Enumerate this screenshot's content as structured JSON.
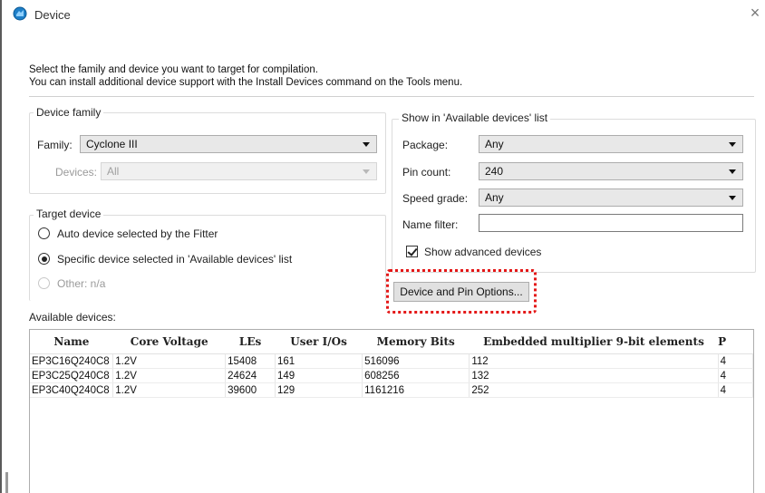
{
  "window": {
    "title": "Device",
    "close_glyph": "×"
  },
  "intro": {
    "line1": "Select the family and device you want to target for compilation.",
    "line2": "You can install additional device support with the Install Devices command on the Tools menu."
  },
  "device_family": {
    "legend": "Device family",
    "family_label": "Family:",
    "family_value": "Cyclone III",
    "devices_label": "Devices:",
    "devices_value": "All"
  },
  "target_device": {
    "legend": "Target device",
    "options": [
      {
        "label": "Auto device selected by the Fitter",
        "checked": false,
        "enabled": true
      },
      {
        "label": "Specific device selected in 'Available devices' list",
        "checked": true,
        "enabled": true
      },
      {
        "label": "Other:  n/a",
        "checked": false,
        "enabled": false
      }
    ]
  },
  "show_in_list": {
    "legend": "Show in 'Available devices' list",
    "package_label": "Package:",
    "package_value": "Any",
    "pin_count_label": "Pin count:",
    "pin_count_value": "240",
    "speed_grade_label": "Speed grade:",
    "speed_grade_value": "Any",
    "name_filter_label": "Name filter:",
    "name_filter_value": "",
    "show_advanced_label": "Show advanced devices",
    "show_advanced_checked": true
  },
  "device_pin_options_button": "Device and Pin Options...",
  "available_devices": {
    "label": "Available devices:",
    "columns": [
      "Name",
      "Core Voltage",
      "LEs",
      "User I/Os",
      "Memory Bits",
      "Embedded multiplier 9-bit elements",
      "P"
    ],
    "rows": [
      [
        "EP3C16Q240C8",
        "1.2V",
        "15408",
        "161",
        "516096",
        "112",
        "4"
      ],
      [
        "EP3C25Q240C8",
        "1.2V",
        "24624",
        "149",
        "608256",
        "132",
        "4"
      ],
      [
        "EP3C40Q240C8",
        "1.2V",
        "39600",
        "129",
        "1161216",
        "252",
        "4"
      ]
    ]
  },
  "colors": {
    "highlight": "#e41818",
    "title_icon": "#1e7fc8"
  },
  "icons": {
    "title": "device-chip-icon",
    "close": "close-icon",
    "dropdown": "chevron-down-icon"
  }
}
